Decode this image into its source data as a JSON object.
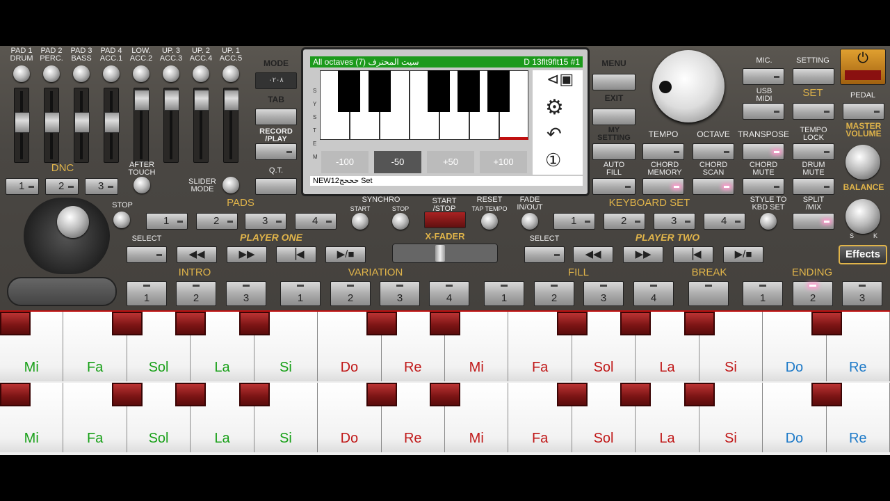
{
  "top_labels": [
    "PAD 1\nDRUM",
    "PAD 2\nPERC.",
    "PAD 3\nBASS",
    "PAD 4\nACC.1",
    "LOW.\nACC.2",
    "UP. 3\nACC.3",
    "UP. 2\nACC.4",
    "UP. 1\nACC.5"
  ],
  "left": {
    "mode": "MODE",
    "mode_value": "۰۲۰۸",
    "tab": "TAB",
    "record": "RECORD\n/PLAY",
    "qt": "Q.T.",
    "dnc": "DNC",
    "dnc_buttons": [
      "1",
      "2",
      "3"
    ],
    "after_touch": "AFTER\nTOUCH",
    "slider_mode": "SLIDER\nMODE",
    "stop": "STOP",
    "pads": "PADS",
    "pad_buttons": [
      "1",
      "2",
      "3",
      "4"
    ],
    "select": "SELECT",
    "player_one": "PLAYER ONE"
  },
  "screen": {
    "header": "All octaves (7) سيت المحترف",
    "header_right": "D 13flt9flt15 #1",
    "side_letters": [
      "S",
      "Y",
      "S",
      "T",
      "E",
      "M"
    ],
    "octaves": [
      "-100",
      "-50",
      "+50",
      "+100"
    ],
    "footer": "NEW12حححج Set"
  },
  "center": {
    "synchro": "SYNCHRO",
    "start": "START",
    "stop": "STOP",
    "start_stop": "START\n/STOP",
    "reset": "RESET",
    "tap_tempo": "TAP TEMPO",
    "fade": "FADE\nIN/OUT",
    "xfader": "X-FADER"
  },
  "right": {
    "menu": "MENU",
    "exit": "EXIT",
    "my_setting": "MY\nSETTING",
    "auto_fill": "AUTO\nFILL",
    "mic": "MIC.",
    "setting": "SETTING",
    "usb_midi": "USB\nMIDI",
    "set": "SET",
    "pedal": "PEDAL",
    "master_volume": "MASTER\nVOLUME",
    "balance": "BALANCE",
    "tempo": "TEMPO",
    "octave": "OCTAVE",
    "transpose": "TRANSPOSE",
    "tempo_lock": "TEMPO\nLOCK",
    "chord_memory": "CHORD\nMEMORY",
    "chord_scan": "CHORD\nSCAN",
    "chord_mute": "CHORD\nMUTE",
    "drum_mute": "DRUM\nMUTE",
    "keyboard_set": "KEYBOARD SET",
    "kbd_buttons": [
      "1",
      "2",
      "3",
      "4"
    ],
    "style_to_kbd": "STYLE TO\nKBD SET",
    "split_mix": "SPLIT\n/MIX",
    "select": "SELECT",
    "player_two": "PLAYER TWO",
    "effects": "Effects",
    "s": "S",
    "k": "K"
  },
  "sections": {
    "intro": "INTRO",
    "variation": "VARIATION",
    "fill": "FILL",
    "break": "BREAK",
    "ending": "ENDING",
    "intro_btns": [
      "1",
      "2",
      "3"
    ],
    "variation_btns": [
      "1",
      "2",
      "3",
      "4"
    ],
    "fill_btns": [
      "1",
      "2",
      "3",
      "4"
    ],
    "ending_btns": [
      "1",
      "2",
      "3"
    ]
  },
  "keys": [
    {
      "n": "Mi",
      "c": "#18a018"
    },
    {
      "n": "Fa",
      "c": "#18a018"
    },
    {
      "n": "Sol",
      "c": "#18a018"
    },
    {
      "n": "La",
      "c": "#18a018"
    },
    {
      "n": "Si",
      "c": "#18a018"
    },
    {
      "n": "Do",
      "c": "#c01818"
    },
    {
      "n": "Re",
      "c": "#c01818"
    },
    {
      "n": "Mi",
      "c": "#c01818"
    },
    {
      "n": "Fa",
      "c": "#c01818"
    },
    {
      "n": "Sol",
      "c": "#c01818"
    },
    {
      "n": "La",
      "c": "#c01818"
    },
    {
      "n": "Si",
      "c": "#c01818"
    },
    {
      "n": "Do",
      "c": "#1e7ac8"
    },
    {
      "n": "Re",
      "c": "#1e7ac8"
    }
  ]
}
